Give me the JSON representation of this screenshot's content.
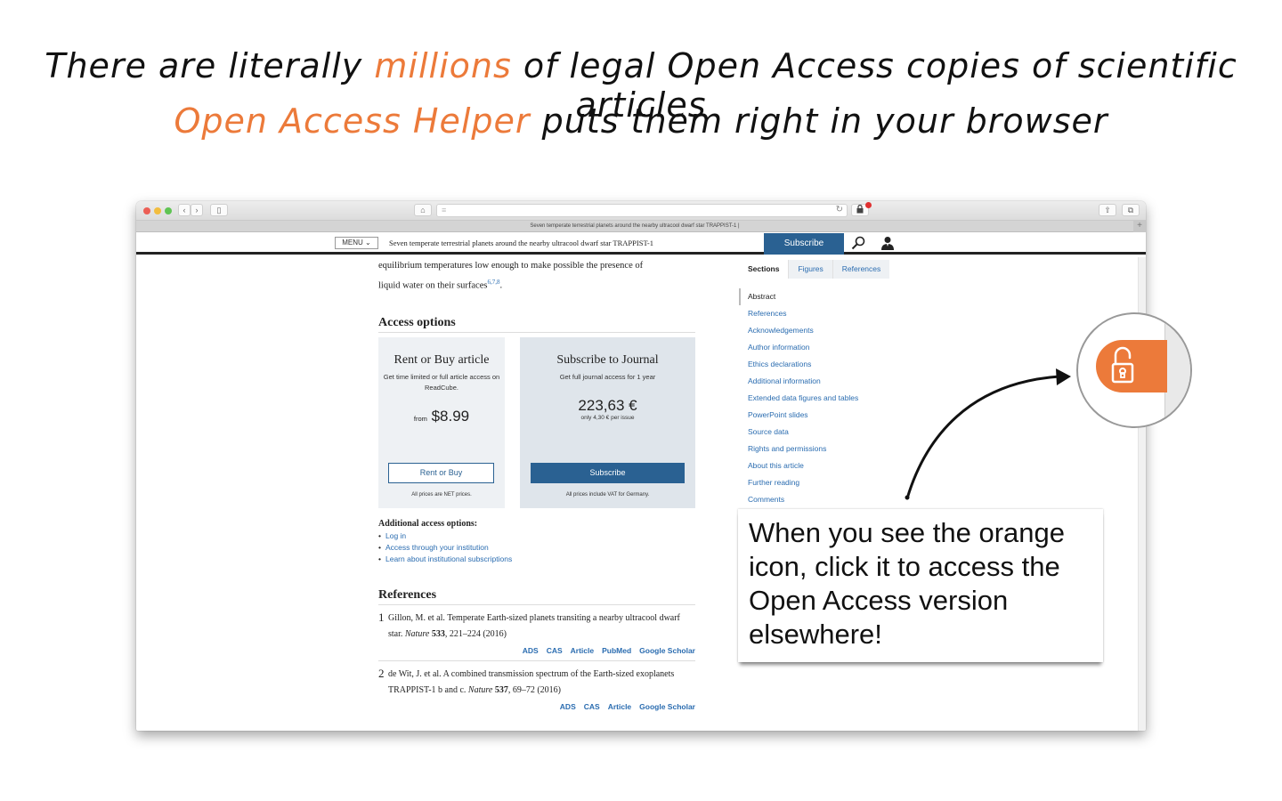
{
  "headline": {
    "line1_pre": "There are literally ",
    "line1_accent": "millions",
    "line1_post": " of legal Open Access copies of scientific articles",
    "line2_accent": "Open Access Helper",
    "line2_post": " puts them right in your browser",
    "accent_color": "#ec7a3a"
  },
  "browser": {
    "tab_title": "Seven temperate terrestrial planets around the nearby ultracool dwarf star TRAPPIST-1 |",
    "icons": {
      "back": "‹",
      "forward": "›",
      "sidebar": "▯",
      "home": "⌂",
      "reader": "≡",
      "reload": "↻",
      "extension_lock": "🔒",
      "share": "⇧",
      "tabs": "⧉",
      "new_tab": "+"
    }
  },
  "site": {
    "menu_label": "MENU ⌄",
    "article_title": "Seven temperate terrestrial planets around the nearby ultracool dwarf star TRAPPIST-1",
    "subscribe_label": "Subscribe",
    "brand_color": "#2a6192"
  },
  "article": {
    "para_line1": "equilibrium temperatures low enough to make possible the presence of",
    "para_line2": "liquid water on their surfaces",
    "para_cites": "6,7,8",
    "para_end": ".",
    "access_heading": "Access options",
    "rent_card": {
      "title": "Rent or Buy article",
      "desc": "Get time limited or full article access on ReadCube.",
      "price_prefix": "from",
      "price": "$8.99",
      "button": "Rent or Buy",
      "fine": "All prices are NET prices."
    },
    "subscribe_card": {
      "title": "Subscribe to Journal",
      "desc": "Get full journal access for 1 year",
      "price": "223,63 €",
      "note": "only 4,30 € per issue",
      "button": "Subscribe",
      "fine": "All prices include VAT for Germany."
    },
    "additional_heading": "Additional access options:",
    "additional_links": [
      "Log in",
      "Access through your institution",
      "Learn about institutional subscriptions"
    ],
    "references_heading": "References",
    "references": [
      {
        "num": "1",
        "text_pre": "Gillon, M. et al. Temperate Earth-sized planets transiting a nearby ultracool dwarf star. ",
        "journal": "Nature",
        "volume": "533",
        "text_post": ", 221–224 (2016)",
        "links": [
          "ADS",
          "CAS",
          "Article",
          "PubMed",
          "Google Scholar"
        ]
      },
      {
        "num": "2",
        "text_pre": "de Wit, J. et al. A combined transmission spectrum of the Earth-sized exoplanets TRAPPIST-1 b and c. ",
        "journal": "Nature",
        "volume": "537",
        "text_post": ", 69–72 (2016)",
        "links": [
          "ADS",
          "CAS",
          "Article",
          "Google Scholar"
        ]
      }
    ]
  },
  "sidebar": {
    "tabs": [
      "Sections",
      "Figures",
      "References"
    ],
    "active_tab": "Sections",
    "items": [
      "Abstract",
      "References",
      "Acknowledgements",
      "Author information",
      "Ethics declarations",
      "Additional information",
      "Extended data figures and tables",
      "PowerPoint slides",
      "Source data",
      "Rights and permissions",
      "About this article",
      "Further reading",
      "Comments"
    ],
    "active_item": "Abstract"
  },
  "callout": {
    "text": "When you see the orange icon, click it to access the Open Access version elsewhere!"
  },
  "magnifier": {
    "icon": "open-lock",
    "color": "#ec7a3a"
  }
}
